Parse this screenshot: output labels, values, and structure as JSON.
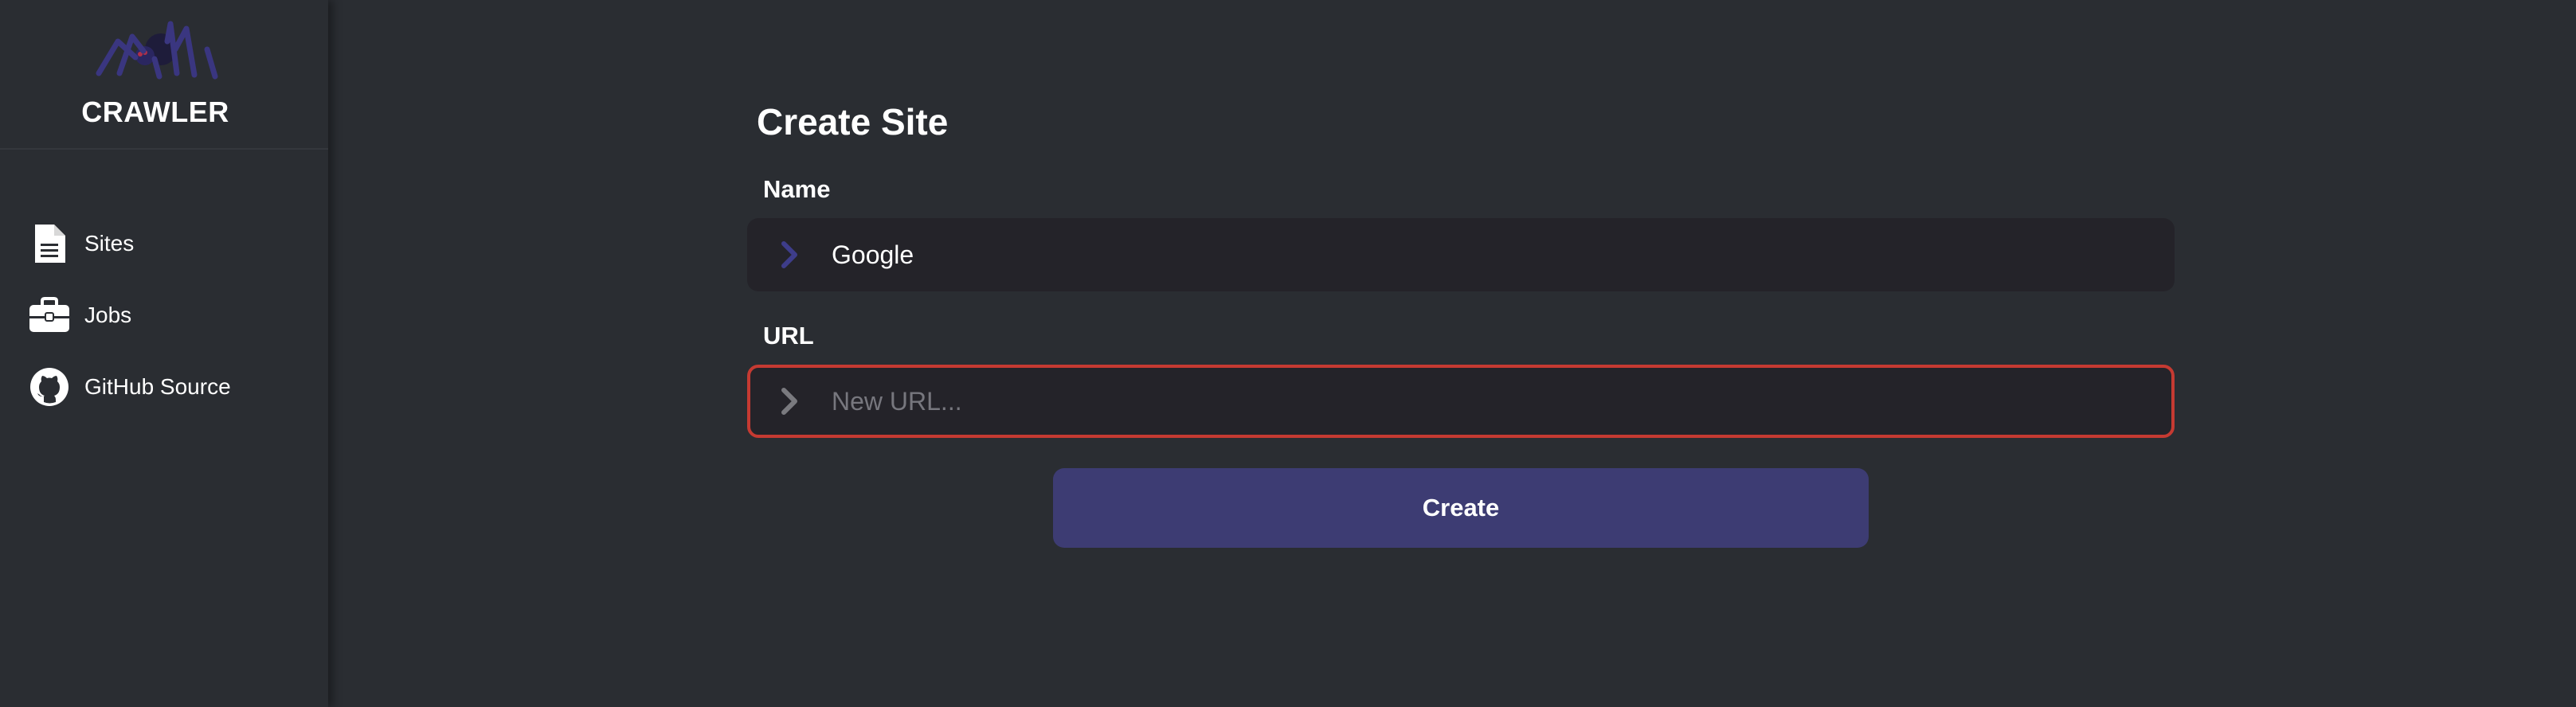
{
  "sidebar": {
    "brand": {
      "title": "CRAWLER",
      "logo_icon": "spider-logo-icon"
    },
    "items": [
      {
        "label": "Sites",
        "icon": "file-icon"
      },
      {
        "label": "Jobs",
        "icon": "briefcase-icon"
      },
      {
        "label": "GitHub Source",
        "icon": "github-icon"
      }
    ]
  },
  "main": {
    "form": {
      "title": "Create Site",
      "name": {
        "label": "Name",
        "value": "Google",
        "chevron_color": "#3e3d8a"
      },
      "url": {
        "label": "URL",
        "value": "",
        "placeholder": "New URL...",
        "chevron_color": "#7a7a7f",
        "error_border_color": "#c53a32"
      },
      "submit_label": "Create"
    }
  },
  "colors": {
    "background": "#2a2d32",
    "input_background": "#242329",
    "accent": "#3d3c73",
    "error": "#c53a32"
  }
}
